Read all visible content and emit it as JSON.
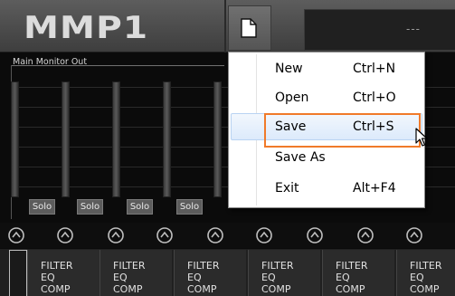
{
  "app": {
    "logo": "MMP1",
    "display_text": "---"
  },
  "monitor": {
    "title": "Main Monitor Out",
    "solo_buttons": [
      "Solo",
      "Solo",
      "Solo",
      "Solo"
    ]
  },
  "menu": {
    "items": [
      {
        "label": "New",
        "shortcut": "Ctrl+N"
      },
      {
        "label": "Open",
        "shortcut": "Ctrl+O"
      },
      {
        "label": "Save",
        "shortcut": "Ctrl+S"
      },
      {
        "label": "Save As",
        "shortcut": ""
      },
      {
        "label": "Exit",
        "shortcut": "Alt+F4"
      }
    ],
    "highlighted_index": 2
  },
  "strips": [
    {
      "line1": "",
      "line2": "",
      "line3": ""
    },
    {
      "line1": "FILTER",
      "line2": "EQ",
      "line3": "COMP"
    },
    {
      "line1": "FILTER",
      "line2": "EQ",
      "line3": "COMP"
    },
    {
      "line1": "FILTER",
      "line2": "EQ",
      "line3": "COMP"
    },
    {
      "line1": "FILTER",
      "line2": "EQ",
      "line3": "COMP"
    },
    {
      "line1": "FILTER",
      "line2": "EQ",
      "line3": "COMP"
    },
    {
      "line1": "FILTER",
      "line2": "EQ",
      "line3": "COMP"
    }
  ],
  "icons": {
    "file_menu": "document-icon",
    "knob": "knob-icon",
    "cursor": "mouse-pointer-icon"
  },
  "colors": {
    "focus_outline": "#f07a2a",
    "menu_highlight": "#dceafb"
  }
}
